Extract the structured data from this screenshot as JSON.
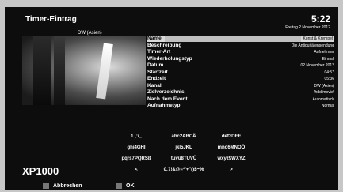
{
  "header": {
    "title": "Timer-Eintrag",
    "clock": "5:22",
    "date": "Freitag  2.November 2012"
  },
  "preview": {
    "channel": "DW (Asien)"
  },
  "form": {
    "rows": [
      {
        "label": "Name",
        "value": "Kunst & Krempel"
      },
      {
        "label": "Beschreibung",
        "value": "Die Antiquitätensendung"
      },
      {
        "label": "Timer-Art",
        "value": "Aufnehmen"
      },
      {
        "label": "Wiederholungstyp",
        "value": "Einmal"
      },
      {
        "label": "Datum",
        "value": "02.November 2012"
      },
      {
        "label": "Startzeit",
        "value": "04:57"
      },
      {
        "label": "Endzeit",
        "value": "05:36"
      },
      {
        "label": "Kanal",
        "value": "DW (Asien)"
      },
      {
        "label": "Zielverzeichnis",
        "value": "/hdd/movie/"
      },
      {
        "label": "Nach dem Event",
        "value": "Automatisch"
      },
      {
        "label": "Aufnahmetyp",
        "value": "Normal"
      }
    ]
  },
  "keypad": {
    "keys": [
      [
        "1.,:/_",
        "abc2ABCÄ",
        "def3DEF"
      ],
      [
        "ghi4GHI",
        "jkl5JKL",
        "mno6MNOÖ"
      ],
      [
        "pqrs7PQRSß",
        "tuvü8TUVÜ",
        "wxyz9WXYZ"
      ],
      [
        "<",
        "0,?!&@=*'+\"()$~%",
        ">"
      ]
    ]
  },
  "brand": {
    "logo": "XP1000"
  },
  "footer": {
    "cancel_label": "Abbrechen",
    "ok_label": "OK"
  },
  "colors": {
    "red_button": "#777777",
    "green_button": "#777777"
  }
}
